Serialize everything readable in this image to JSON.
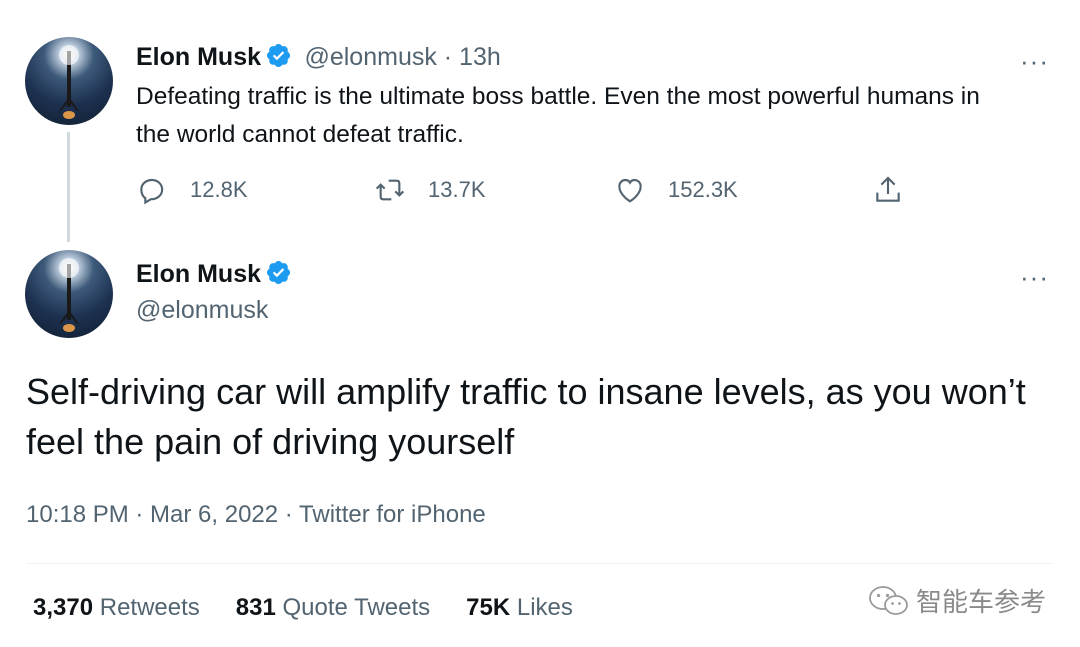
{
  "tweet1": {
    "name": "Elon Musk",
    "handle_time": "@elonmusk · 13h",
    "text": "Defeating traffic is the ultimate boss battle. Even the most powerful humans in the world cannot defeat traffic.",
    "replies": "12.8K",
    "retweets": "13.7K",
    "likes": "152.3K",
    "more": "···"
  },
  "tweet2": {
    "name": "Elon Musk",
    "handle": "@elonmusk",
    "text": "Self-driving car will amplify traffic to insane levels, as you won’t feel the pain of driving yourself",
    "meta": "10:18 PM · Mar 6, 2022 · Twitter for iPhone",
    "more": "···"
  },
  "stats": {
    "retweets_count": "3,370",
    "retweets_label": "Retweets",
    "quotes_count": "831",
    "quotes_label": "Quote Tweets",
    "likes_count": "75K",
    "likes_label": "Likes"
  },
  "watermark": {
    "text": "智能车参考",
    "icon": "wechat-icon"
  },
  "colors": {
    "verified": "#1d9bf0",
    "secondary": "#536471",
    "primary": "#0f1419"
  }
}
